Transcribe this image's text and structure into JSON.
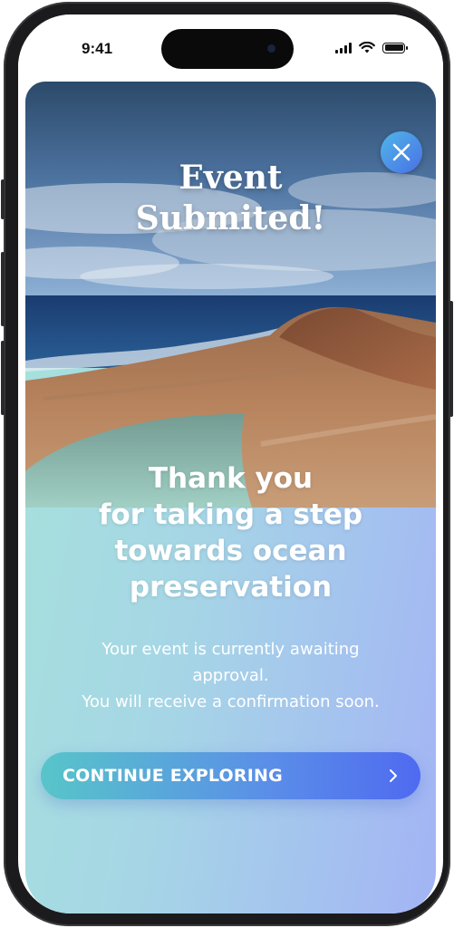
{
  "status_bar": {
    "time": "9:41"
  },
  "modal": {
    "headline_line1": "Event",
    "headline_line2": "Submited!",
    "thanks_line1": "Thank you",
    "thanks_line2": "for taking a step",
    "thanks_line3": "towards ocean",
    "thanks_line4": "preservation",
    "sub_line1": "Your event is currently awaiting",
    "sub_line2": "approval.",
    "sub_line3": "You will receive a confirmation soon.",
    "cta_label": "CONTINUE EXPLORING",
    "close_icon": "close-icon",
    "cta_icon": "chevron-right-icon"
  },
  "colors": {
    "gradient_start": "#a6e3da",
    "gradient_end": "#a3b4f5",
    "cta_start": "#58c5c9",
    "cta_end": "#4f6af0",
    "close_button": "#4b8fe6"
  }
}
